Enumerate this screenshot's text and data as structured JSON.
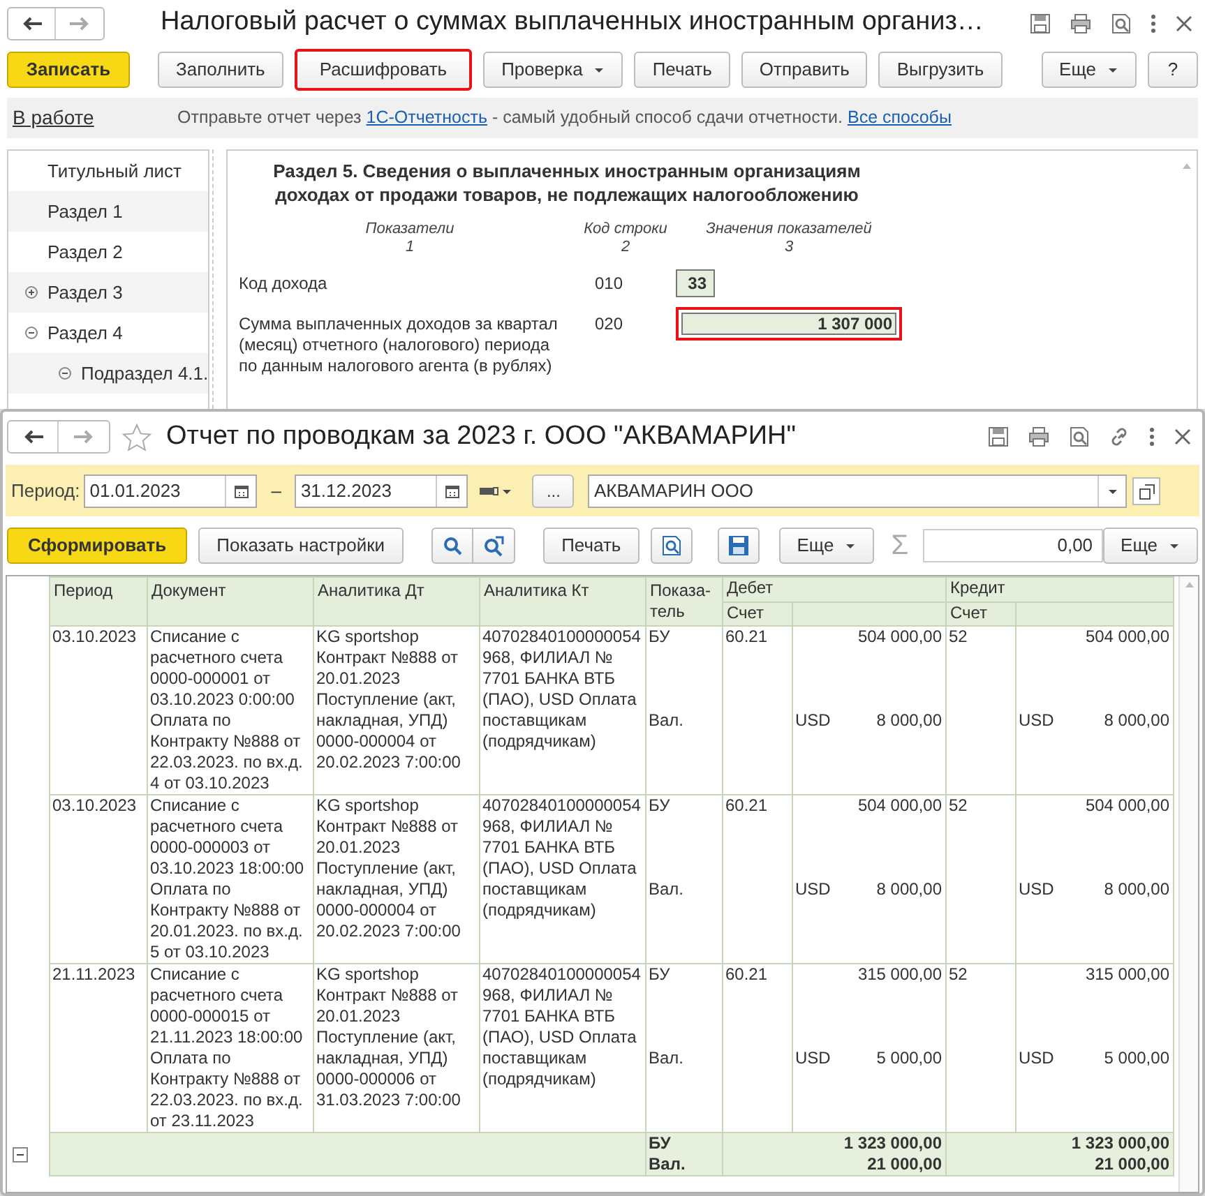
{
  "doc_window": {
    "title": "Налоговый расчет о суммах выплаченных иностранным организ…",
    "toolbar": [
      {
        "label": "Записать",
        "kind": "primary",
        "highlighted": false
      },
      {
        "label": "Заполнить",
        "kind": "plain",
        "highlighted": false
      },
      {
        "label": "Расшифровать",
        "kind": "plain",
        "highlighted": true
      },
      {
        "label": "Проверка",
        "kind": "dropdown",
        "highlighted": false
      },
      {
        "label": "Печать",
        "kind": "plain",
        "highlighted": false
      },
      {
        "label": "Отправить",
        "kind": "plain",
        "highlighted": false
      },
      {
        "label": "Выгрузить",
        "kind": "plain",
        "highlighted": false
      }
    ],
    "toolbar_right": [
      {
        "label": "Еще",
        "kind": "dropdown"
      },
      {
        "label": "?",
        "kind": "plain"
      }
    ],
    "status": {
      "label": "В работе",
      "message": [
        {
          "text": "Отправьте отчет через ",
          "link": false
        },
        {
          "text": "1С-Отчетность",
          "link": true
        },
        {
          "text": " - самый удобный способ сдачи отчетности. ",
          "link": false
        },
        {
          "text": "Все способы",
          "link": true
        }
      ]
    },
    "sidebar": {
      "items": [
        {
          "label": "Титульный лист",
          "kind": "leaf"
        },
        {
          "label": "Раздел 1",
          "kind": "leaf"
        },
        {
          "label": "Раздел 2",
          "kind": "leaf"
        },
        {
          "label": "Раздел 3",
          "kind": "group",
          "expanded": false
        },
        {
          "label": "Раздел 4",
          "kind": "group",
          "expanded": true,
          "children": [
            {
              "label": "Подраздел 4.1.",
              "kind": "group",
              "expanded": true
            }
          ]
        }
      ]
    },
    "form": {
      "heading_lines": [
        "Раздел 5. Сведения о выплаченных иностранным организациям",
        "доходах от продажи товаров, не подлежащих налогообложению"
      ],
      "columns": [
        {
          "label": "Показатели",
          "number": "1"
        },
        {
          "label": "Код строки",
          "number": "2"
        },
        {
          "label": "Значения показателей",
          "number": "3"
        }
      ],
      "rows": [
        {
          "label": "Код дохода",
          "code": "010",
          "value": "33",
          "kind": "short",
          "highlighted": false
        },
        {
          "label": "Сумма выплаченных доходов за квартал (месяц) отчетного (налогового) периода по данным налогового агента (в рублях)",
          "code": "020",
          "value": "1 307 000",
          "kind": "wide",
          "highlighted": true
        }
      ]
    }
  },
  "report_window": {
    "title": "Отчет по проводкам за 2023 г. ООО \"АКВАМАРИН\"",
    "favorite": false,
    "filter": {
      "period_label": "Период:",
      "date_from": "01.01.2023",
      "dash": "–",
      "date_to": "31.12.2023",
      "ellipsis": "...",
      "organization": "АКВАМАРИН ООО"
    },
    "toolbar": {
      "generate": "Сформировать",
      "settings": "Показать настройки",
      "print": "Печать",
      "more": "Еще",
      "sum_sign": "Σ",
      "sum": "0,00",
      "more_right": "Еще"
    },
    "table": {
      "columns": [
        "Период",
        "Документ",
        "Аналитика Дт",
        "Аналитика Кт",
        "Показа-тель"
      ],
      "debit": {
        "label": "Дебет",
        "account": "Счет"
      },
      "credit": {
        "label": "Кредит",
        "account": "Счет"
      },
      "rows": [
        {
          "period": "03.10.2023",
          "document": "Списание с расчетного счета 0000-000001 от 03.10.2023 0:00:00 Оплата по Контракту №888 от 22.03.2023. по вх.д. 4 от 03.10.2023",
          "analytics_dt": "KG sportshop Контракт №888 от 20.01.2023 Поступление (акт, накладная, УПД) 0000-000004 от 20.02.2023 7:00:00",
          "analytics_kt": "40702840100000054968, ФИЛИАЛ № 7701 БАНКА ВТБ (ПАО), USD Оплата поставщикам (подрядчикам)",
          "indicators": [
            "БУ",
            "Вал."
          ],
          "debit": {
            "account": "60.21",
            "amount": "504 000,00",
            "currency": "USD",
            "currency_amount": "8 000,00"
          },
          "credit": {
            "account": "52",
            "amount": "504 000,00",
            "currency": "USD",
            "currency_amount": "8 000,00"
          }
        },
        {
          "period": "03.10.2023",
          "document": "Списание с расчетного счета 0000-000003 от 03.10.2023 18:00:00 Оплата по Контракту №888 от 20.01.2023. по вх.д. 5 от 03.10.2023",
          "analytics_dt": "KG sportshop Контракт №888 от 20.01.2023 Поступление (акт, накладная, УПД) 0000-000004 от 20.02.2023 7:00:00",
          "analytics_kt": "40702840100000054968, ФИЛИАЛ № 7701 БАНКА ВТБ (ПАО), USD Оплата поставщикам (подрядчикам)",
          "indicators": [
            "БУ",
            "Вал."
          ],
          "debit": {
            "account": "60.21",
            "amount": "504 000,00",
            "currency": "USD",
            "currency_amount": "8 000,00"
          },
          "credit": {
            "account": "52",
            "amount": "504 000,00",
            "currency": "USD",
            "currency_amount": "8 000,00"
          }
        },
        {
          "period": "21.11.2023",
          "document": "Списание с расчетного счета 0000-000015 от 21.11.2023 18:00:00 Оплата по Контракту №888 от 22.03.2023. по вх.д. от 23.11.2023",
          "analytics_dt": "KG sportshop Контракт №888 от 20.01.2023 Поступление (акт, накладная, УПД) 0000-000006 от 31.03.2023 7:00:00",
          "analytics_kt": "40702840100000054968, ФИЛИАЛ № 7701 БАНКА ВТБ (ПАО), USD Оплата поставщикам (подрядчикам)",
          "indicators": [
            "БУ",
            "Вал."
          ],
          "debit": {
            "account": "60.21",
            "amount": "315 000,00",
            "currency": "USD",
            "currency_amount": "5 000,00"
          },
          "credit": {
            "account": "52",
            "amount": "315 000,00",
            "currency": "USD",
            "currency_amount": "5 000,00"
          }
        }
      ],
      "totals": {
        "indicators": [
          "БУ",
          "Вал."
        ],
        "debit": [
          "1 323 000,00",
          "21 000,00"
        ],
        "credit": [
          "1 323 000,00",
          "21 000,00"
        ]
      }
    }
  }
}
